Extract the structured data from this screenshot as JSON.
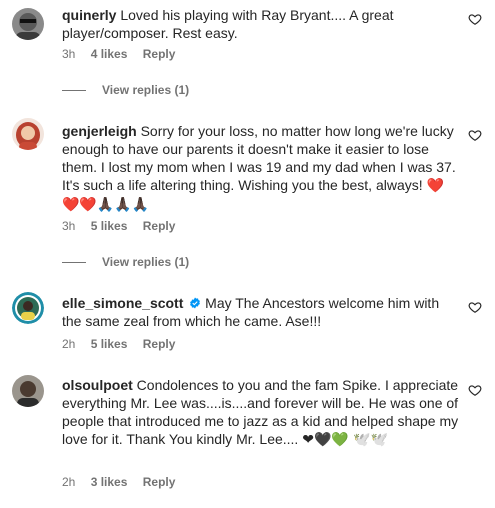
{
  "comments": [
    {
      "username": "quinerly",
      "text": "Loved his playing with Ray Bryant.... A great player/composer. Rest easy.",
      "time": "3h",
      "likes": "4 likes",
      "reply": "Reply",
      "view_replies": "View replies (1)",
      "avatar_icon": "avatar-sunglasses-icon"
    },
    {
      "username": "genjerleigh",
      "text": "Sorry for your loss, no matter how long we're lucky enough to have our parents it doesn't make it easier to lose them. I lost my mom when I was 19 and my dad when I was 37. It's such a life altering thing. Wishing you the best, always! ",
      "emoji": "❤️❤️❤️🙏🏿🙏🏿🙏🏿",
      "time": "3h",
      "likes": "5 likes",
      "reply": "Reply",
      "view_replies": "View replies (1)",
      "avatar_icon": "avatar-redhair-icon"
    },
    {
      "username": "elle_simone_scott",
      "verified": true,
      "text": "May The Ancestors welcome him with the same zeal from which he came. Ase!!!",
      "time": "2h",
      "likes": "5 likes",
      "reply": "Reply",
      "avatar_icon": "avatar-story-ring-icon"
    },
    {
      "username": "olsoulpoet",
      "text": "Condolences to you and the fam Spike. I appreciate everything Mr. Lee was....is....and forever will be. He was one of people that introduced me to jazz as a kid and helped shape my love for it. Thank You kindly Mr. Lee....",
      "emoji": "❤🖤💚 🕊️🕊️",
      "time": "2h",
      "likes": "3 likes",
      "reply": "Reply",
      "avatar_icon": "avatar-man-icon"
    }
  ],
  "colors": {
    "text": "#262626",
    "secondary": "#737373",
    "verified": "#0095f6"
  }
}
